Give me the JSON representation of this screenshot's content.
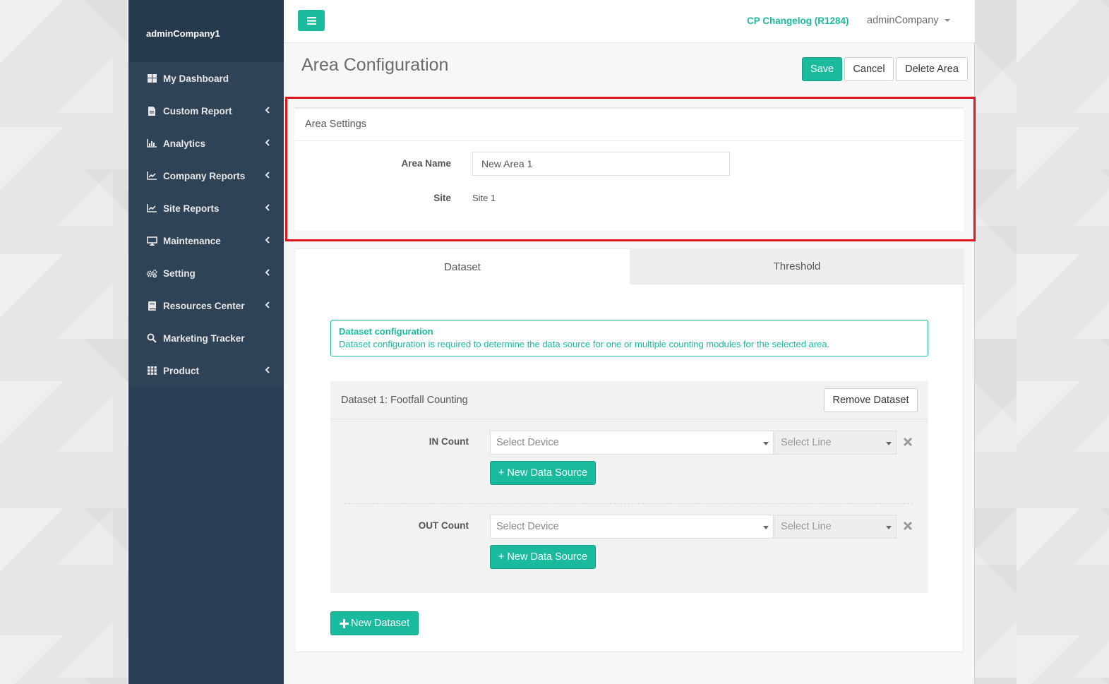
{
  "sidebar": {
    "brand": "adminCompany1",
    "items": [
      {
        "label": "My Dashboard",
        "icon": "dashboard-icon",
        "has_chevron": false
      },
      {
        "label": "Custom Report",
        "icon": "document-icon",
        "has_chevron": true
      },
      {
        "label": "Analytics",
        "icon": "bar-chart-icon",
        "has_chevron": true
      },
      {
        "label": "Company Reports",
        "icon": "line-chart-icon",
        "has_chevron": true
      },
      {
        "label": "Site Reports",
        "icon": "line-chart-icon",
        "has_chevron": true
      },
      {
        "label": "Maintenance",
        "icon": "monitor-icon",
        "has_chevron": true
      },
      {
        "label": "Setting",
        "icon": "gears-icon",
        "has_chevron": true
      },
      {
        "label": "Resources Center",
        "icon": "book-icon",
        "has_chevron": true
      },
      {
        "label": "Marketing Tracker",
        "icon": "search-icon",
        "has_chevron": false
      },
      {
        "label": "Product",
        "icon": "grid-icon",
        "has_chevron": true
      }
    ]
  },
  "topbar": {
    "changelog": "CP Changelog (R1284)",
    "user": "adminCompany"
  },
  "page": {
    "title": "Area Configuration",
    "save": "Save",
    "cancel": "Cancel",
    "delete": "Delete Area"
  },
  "area_settings": {
    "title": "Area Settings",
    "area_name_label": "Area Name",
    "area_name_value": "New Area 1",
    "site_label": "Site",
    "site_value": "Site 1"
  },
  "tabs": {
    "dataset": "Dataset",
    "threshold": "Threshold"
  },
  "alert": {
    "title": "Dataset configuration",
    "text": "Dataset configuration is required to determine the data source for one or multiple counting modules for the selected area."
  },
  "dataset": {
    "title": "Dataset 1: Footfall Counting",
    "remove": "Remove Dataset",
    "rows": [
      {
        "label": "IN Count",
        "device_placeholder": "Select Device",
        "line_placeholder": "Select Line",
        "add_source": "+ New Data Source"
      },
      {
        "label": "OUT Count",
        "device_placeholder": "Select Device",
        "line_placeholder": "Select Line",
        "add_source": "+ New Data Source"
      }
    ],
    "new_dataset": "New Dataset"
  },
  "colors": {
    "accent": "#1abb9c",
    "sidebar": "#2a3f54",
    "highlight": "#e0151b"
  }
}
